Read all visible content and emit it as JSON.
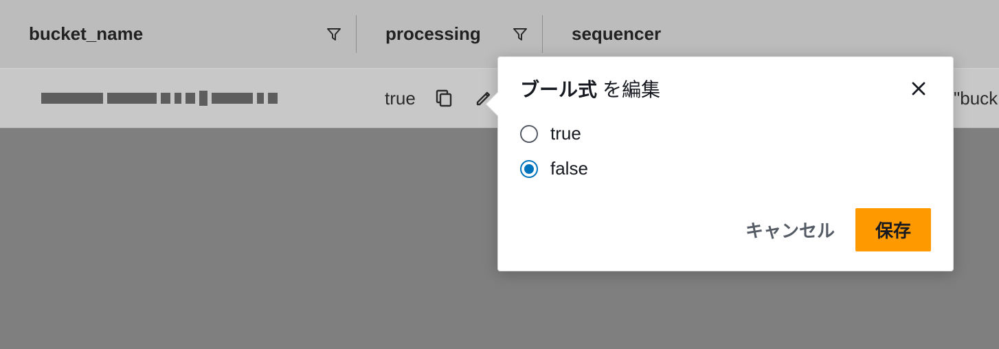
{
  "columns": {
    "bucket_name": "bucket_name",
    "processing": "processing",
    "sequencer": "sequencer"
  },
  "row": {
    "processing_value": "true",
    "sequencer_preview": "\"buck"
  },
  "popover": {
    "title_bold": "ブール式",
    "title_rest": "を編集",
    "options": {
      "true": "true",
      "false": "false"
    },
    "selected": "false",
    "cancel": "キャンセル",
    "save": "保存"
  }
}
